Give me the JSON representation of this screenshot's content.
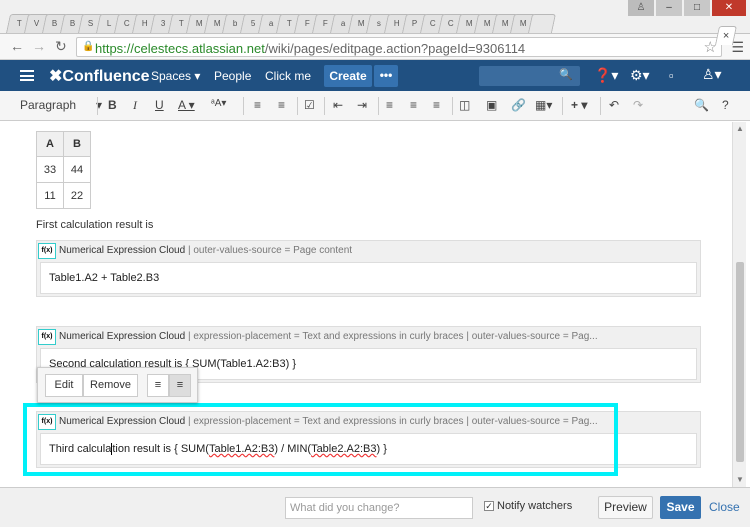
{
  "browser": {
    "tabs": [
      "T",
      "V",
      "B",
      "B",
      "S",
      "L",
      "",
      "C",
      "H",
      "3",
      "T",
      "M",
      "M",
      "b",
      "5",
      "a",
      "T",
      "F",
      "F",
      "a",
      "M",
      "s",
      "H",
      "P",
      "C",
      "C",
      "M",
      "M",
      "M",
      "M"
    ],
    "url_prefix": "https://",
    "url_host": "celestecs.atlassian.net",
    "url_path": "/wiki/pages/editpage.action?pageId=9306114"
  },
  "header": {
    "logo": "Confluence",
    "spaces": "Spaces",
    "people": "People",
    "clickme": "Click me",
    "create": "Create",
    "more": "•••"
  },
  "toolbar": {
    "paragraph": "Paragraph"
  },
  "content": {
    "table": {
      "headers": [
        "A",
        "B"
      ],
      "rows": [
        [
          "33",
          "44"
        ],
        [
          "11",
          "22"
        ]
      ]
    },
    "first_text": "First calculation result is",
    "macros": [
      {
        "name": "Numerical Expression Cloud",
        "params": " | outer-values-source = Page content",
        "body": "Table1.A2 + Table2.B3"
      },
      {
        "name": "Numerical Expression Cloud",
        "params": " | expression-placement = Text and expressions in curly braces | outer-values-source = Pag...",
        "body": "Second calculation result is { SUM(Table1.A2:B3) }"
      },
      {
        "name": "Numerical Expression Cloud",
        "params": " | expression-placement = Text and expressions in curly braces | outer-values-source = Pag...",
        "body_parts": [
          "Third calcula",
          "tion result is { SUM(",
          "Table1.A2:B3",
          ") / MIN(",
          "Table2.A2:B3",
          ") }"
        ]
      }
    ],
    "icon_text": "f(x)",
    "popup": {
      "edit": "Edit",
      "remove": "Remove"
    }
  },
  "footer": {
    "change_placeholder": "What did you change?",
    "notify": "Notify watchers",
    "preview": "Preview",
    "save": "Save",
    "close": "Close"
  },
  "colors": {
    "header": "#205081",
    "accent": "#3572b0",
    "highlight": "#00f0f8"
  }
}
